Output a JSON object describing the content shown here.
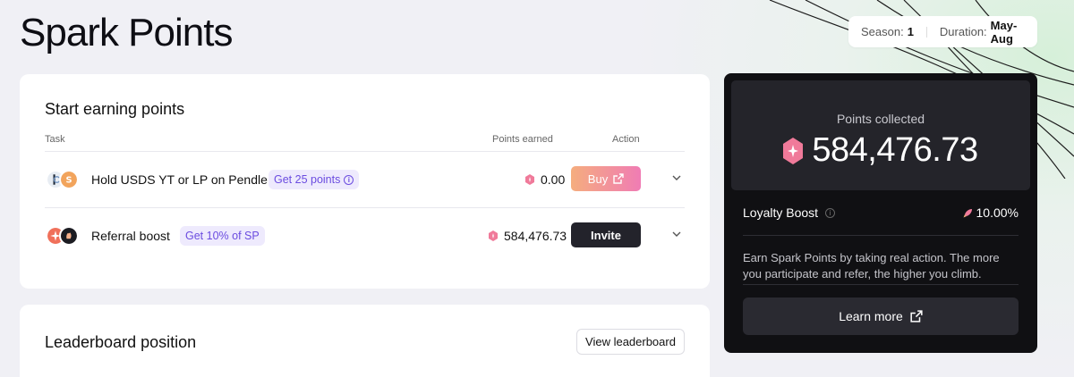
{
  "page": {
    "title": "Spark Points"
  },
  "season": {
    "season_label": "Season:",
    "season_value": "1",
    "duration_label": "Duration:",
    "duration_value": "May-Aug"
  },
  "earn": {
    "title": "Start earning points",
    "headers": {
      "task": "Task",
      "points_earned": "Points earned",
      "action": "Action"
    },
    "rows": [
      {
        "label": "Hold USDS YT or LP on Pendle",
        "badge": "Get 25 points",
        "points": "0.00",
        "action": "Buy"
      },
      {
        "label": "Referral boost",
        "badge": "Get 10% of SP",
        "points": "584,476.73",
        "action": "Invite"
      }
    ]
  },
  "leaderboard": {
    "title": "Leaderboard position",
    "button": "View leaderboard"
  },
  "summary": {
    "points_label": "Points collected",
    "points_value": "584,476.73",
    "loyalty_label": "Loyalty Boost",
    "loyalty_value": "10.00%",
    "description": "Earn Spark Points by taking real action. The more you participate and refer, the higher you climb.",
    "learn_more": "Learn more"
  },
  "colors": {
    "accent_purple": "#6b4ce0",
    "buy_gradient_start": "#f5ad7e",
    "buy_gradient_end": "#f07cb4",
    "dark_panel": "#101013"
  }
}
